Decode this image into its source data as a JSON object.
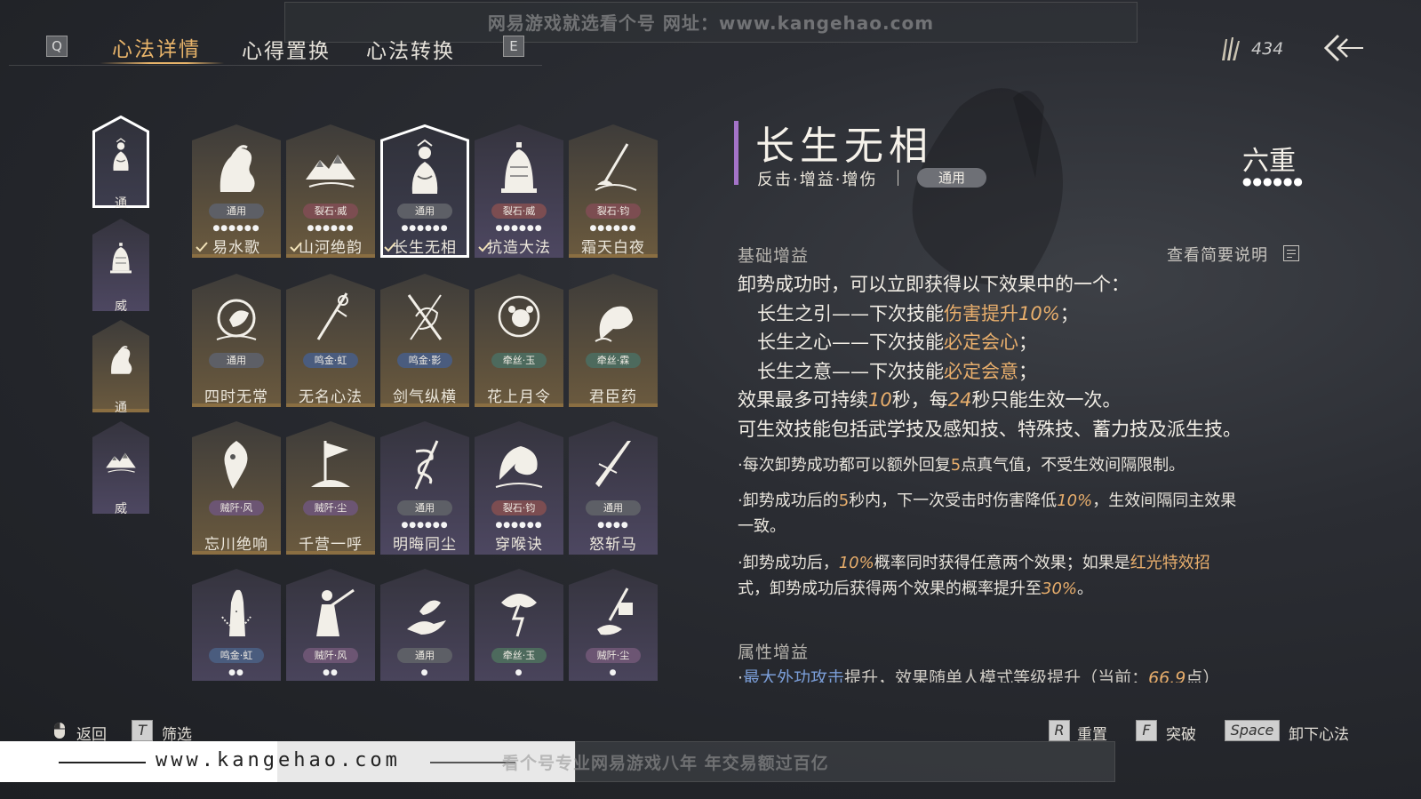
{
  "watermark": {
    "top": "网易游戏就选看个号   网址：www.kangehao.com",
    "bottom_url": "www.kangehao.com",
    "bottom_tag": "看个号专业网易游戏八年  年交易额过百亿"
  },
  "nav": {
    "key_left": "Q",
    "key_right": "E",
    "tabs": [
      "心法详情",
      "心得置换",
      "心法转换"
    ],
    "currency_value": "434"
  },
  "categories": [
    {
      "label": "通",
      "icon": "buddha-icon",
      "selected": true
    },
    {
      "label": "威",
      "icon": "bell-icon",
      "selected": false
    },
    {
      "label": "通",
      "icon": "horse-icon",
      "selected": false
    },
    {
      "label": "威",
      "icon": "mountain-icon",
      "selected": false
    }
  ],
  "cards": [
    {
      "name": "易水歌",
      "tag": "通用",
      "tag_color": "gray",
      "dots": "●●●●●●",
      "checked": true,
      "icon": "horse-icon",
      "bg": "gold"
    },
    {
      "name": "山河绝韵",
      "tag": "裂石·威",
      "tag_color": "red",
      "dots": "●●●●●●",
      "checked": true,
      "icon": "mountain-icon",
      "bg": "gold"
    },
    {
      "name": "长生无相",
      "tag": "通用",
      "tag_color": "gray",
      "dots": "●●●●●●",
      "checked": true,
      "icon": "buddha-icon",
      "bg": "selected"
    },
    {
      "name": "抗造大法",
      "tag": "裂石·威",
      "tag_color": "red",
      "dots": "●●●●●●",
      "checked": true,
      "icon": "bell-icon",
      "bg": "purple"
    },
    {
      "name": "霜天白夜",
      "tag": "裂石·钧",
      "tag_color": "red",
      "dots": "●●●●●●",
      "checked": false,
      "icon": "spear-icon",
      "bg": "gold"
    },
    {
      "name": "四时无常",
      "tag": "通用",
      "tag_color": "gray",
      "dots": "",
      "checked": false,
      "icon": "moon-rabbit-icon",
      "bg": "gold"
    },
    {
      "name": "无名心法",
      "tag": "鸣金·虹",
      "tag_color": "blue",
      "dots": "",
      "checked": false,
      "icon": "sword-icon",
      "bg": "gold"
    },
    {
      "name": "剑气纵横",
      "tag": "鸣金·影",
      "tag_color": "blue",
      "dots": "",
      "checked": false,
      "icon": "crossed-swords-icon",
      "bg": "gold"
    },
    {
      "name": "花上月令",
      "tag": "牵丝·玉",
      "tag_color": "green",
      "dots": "",
      "checked": false,
      "icon": "flower-moon-icon",
      "bg": "gold"
    },
    {
      "name": "君臣药",
      "tag": "牵丝·霖",
      "tag_color": "green",
      "dots": "",
      "checked": false,
      "icon": "herb-icon",
      "bg": "gold"
    },
    {
      "name": "忘川绝响",
      "tag": "贼阡·风",
      "tag_color": "purple",
      "dots": "",
      "checked": false,
      "icon": "ghost-icon",
      "bg": "gold"
    },
    {
      "name": "千营一呼",
      "tag": "贼阡·尘",
      "tag_color": "purple",
      "dots": "",
      "checked": false,
      "icon": "flag-icon",
      "bg": "gold"
    },
    {
      "name": "明晦同尘",
      "tag": "通用",
      "tag_color": "gray",
      "dots": "●●●●●●",
      "checked": false,
      "icon": "snake-sword-icon",
      "bg": "purple"
    },
    {
      "name": "穿喉诀",
      "tag": "裂石·钧",
      "tag_color": "red",
      "dots": "●●●●●●",
      "checked": false,
      "icon": "wave-icon",
      "bg": "purple"
    },
    {
      "name": "怒斩马",
      "tag": "通用",
      "tag_color": "gray",
      "dots": "●●●●",
      "checked": false,
      "icon": "blade-icon",
      "bg": "purple"
    },
    {
      "name": "",
      "tag": "鸣金·虹",
      "tag_color": "blue",
      "dots": "●●",
      "checked": false,
      "icon": "prayer-hands-icon",
      "bg": "purple"
    },
    {
      "name": "",
      "tag": "贼阡·风",
      "tag_color": "purple",
      "dots": "●●",
      "checked": false,
      "icon": "warrior-icon",
      "bg": "purple"
    },
    {
      "name": "",
      "tag": "通用",
      "tag_color": "gray",
      "dots": "●",
      "checked": false,
      "icon": "bird-hand-icon",
      "bg": "purple"
    },
    {
      "name": "",
      "tag": "牵丝·玉",
      "tag_color": "green",
      "dots": "●",
      "checked": false,
      "icon": "lightning-tree-icon",
      "bg": "purple"
    },
    {
      "name": "",
      "tag": "贼阡·尘",
      "tag_color": "purple",
      "dots": "●",
      "checked": false,
      "icon": "bird-house-icon",
      "bg": "purple"
    }
  ],
  "detail": {
    "title": "长生无相",
    "subtitle": "反击·增益·增伤",
    "subtitle_tag": "通用",
    "rank": "六重",
    "rank_dots": "●●●●●●",
    "section_basic": "基础增益",
    "help_label": "查看简要说明",
    "line1": "卸势成功时，可以立即获得以下效果中的一个：",
    "line2_a": "长生之引——下次技能",
    "line2_b": "伤害提升",
    "line2_c": "10%",
    "line2_d": "；",
    "line3_a": "长生之心——下次技能",
    "line3_b": "必定会心",
    "line3_c": "；",
    "line4_a": "长生之意——下次技能",
    "line4_b": "必定会意",
    "line4_c": "；",
    "line5_a": "效果最多可持续",
    "line5_b": "10",
    "line5_c": "秒，每",
    "line5_d": "24",
    "line5_e": "秒只能生效一次。",
    "line6": "可生效技能包括武学技及感知技、特殊技、蓄力技及派生技。",
    "note1_a": "·每次卸势成功都可以额外回复",
    "note1_b": "5",
    "note1_c": "点真气值，不受生效间隔限制。",
    "note2_a": "·卸势成功后的",
    "note2_b": "5",
    "note2_c": "秒内，下一次受击时伤害降低",
    "note2_d": "10%",
    "note2_e": "，生效间隔同主效果",
    "note2_f": "一致。",
    "note3_a": "·卸势成功后，",
    "note3_b": "10%",
    "note3_c": "概率同时获得任意两个效果；如果是",
    "note3_d": "红光特效招",
    "note3_e": "式，卸势成功后获得两个效果的概率提升至",
    "note3_f": "30%",
    "note3_g": "。",
    "section_attr": "属性增益",
    "attr_a": "·",
    "attr_b": "最大外功攻击",
    "attr_c": "提升，效果随单人模式等级提升（当前：",
    "attr_d": "66.9",
    "attr_e": "点）"
  },
  "bottom": {
    "back": "返回",
    "filter_key": "T",
    "filter": "筛选",
    "reset_key": "R",
    "reset": "重置",
    "break_key": "F",
    "break": "突破",
    "unequip_key": "Space",
    "unequip": "卸下心法"
  }
}
